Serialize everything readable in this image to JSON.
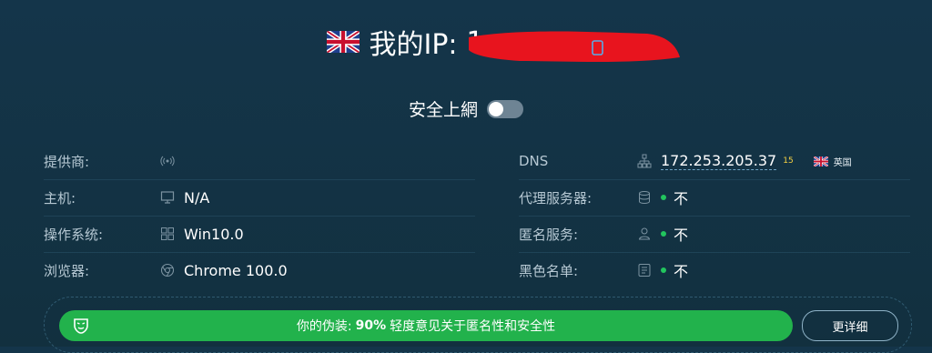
{
  "header": {
    "title": "我的IP:",
    "ip_visible_prefix": "1",
    "flag_icon": "uk-flag-icon",
    "copy_icon": "copy-icon"
  },
  "safe_browsing": {
    "label": "安全上網",
    "enabled": false
  },
  "left_rows": [
    {
      "label": "提供商:",
      "icon": "signal-icon",
      "value": ""
    },
    {
      "label": "主机:",
      "icon": "monitor-icon",
      "value": "N/A"
    },
    {
      "label": "操作系统:",
      "icon": "windows-icon",
      "value": "Win10.0"
    },
    {
      "label": "浏览器:",
      "icon": "chrome-icon",
      "value": "Chrome 100.0"
    }
  ],
  "right_rows": [
    {
      "label": "DNS",
      "icon": "network-icon",
      "value": "172.253.205.37",
      "superscript": "15",
      "country": "英国"
    },
    {
      "label": "代理服务器:",
      "icon": "database-icon",
      "value": "不"
    },
    {
      "label": "匿名服务:",
      "icon": "user-icon",
      "value": "不"
    },
    {
      "label": "黑色名单:",
      "icon": "list-icon",
      "value": "不"
    }
  ],
  "footer": {
    "disguise_prefix": "你的伪装:",
    "disguise_percent": "90%",
    "disguise_text": "轻度意见关于匿名性和安全性",
    "more_button": "更详细"
  },
  "colors": {
    "background": "#14354a",
    "accent_green": "#22b24c",
    "status_dot": "#22c55e"
  }
}
